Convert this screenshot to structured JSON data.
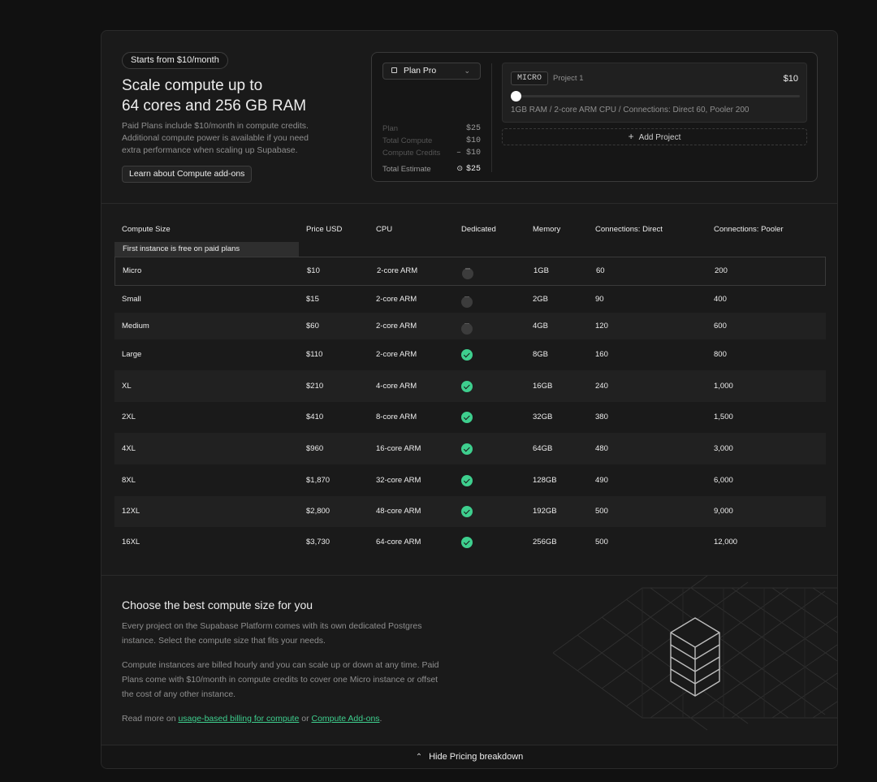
{
  "intro": {
    "pill": "Starts from $10/month",
    "headline_l1": "Scale compute up to",
    "headline_l2": "64 cores and 256 GB RAM",
    "description": "Paid Plans include $10/month in compute credits. Additional compute power is available if you need extra performance when scaling up Supabase.",
    "learn_button": "Learn about Compute add-ons"
  },
  "calculator": {
    "plan_select": "Plan Pro",
    "summary": [
      {
        "label": "Plan",
        "value": "$25"
      },
      {
        "label": "Total Compute",
        "value": "$10"
      },
      {
        "label": "Compute Credits",
        "value": "– $10"
      }
    ],
    "total_label": "Total Estimate",
    "total_value": "$25",
    "project": {
      "size_tag": "MICRO",
      "name": "Project 1",
      "price": "$10",
      "slider_position": 0,
      "specs": "1GB RAM / 2-core ARM CPU / Connections: Direct 60, Pooler 200"
    },
    "add_project": "Add Project"
  },
  "table": {
    "headers": [
      "Compute Size",
      "Price USD",
      "CPU",
      "Dedicated",
      "Memory",
      "Connections: Direct",
      "Connections: Pooler"
    ],
    "free_note": "First instance is free on paid plans",
    "rows": [
      {
        "size": "Micro",
        "price": "$10",
        "cpu": "2-core ARM",
        "dedicated": false,
        "memory": "1GB",
        "direct": "60",
        "pooler": "200"
      },
      {
        "size": "Small",
        "price": "$15",
        "cpu": "2-core ARM",
        "dedicated": false,
        "memory": "2GB",
        "direct": "90",
        "pooler": "400"
      },
      {
        "size": "Medium",
        "price": "$60",
        "cpu": "2-core ARM",
        "dedicated": false,
        "memory": "4GB",
        "direct": "120",
        "pooler": "600"
      },
      {
        "size": "Large",
        "price": "$110",
        "cpu": "2-core ARM",
        "dedicated": true,
        "memory": "8GB",
        "direct": "160",
        "pooler": "800"
      },
      {
        "size": "XL",
        "price": "$210",
        "cpu": "4-core ARM",
        "dedicated": true,
        "memory": "16GB",
        "direct": "240",
        "pooler": "1,000"
      },
      {
        "size": "2XL",
        "price": "$410",
        "cpu": "8-core ARM",
        "dedicated": true,
        "memory": "32GB",
        "direct": "380",
        "pooler": "1,500"
      },
      {
        "size": "4XL",
        "price": "$960",
        "cpu": "16-core ARM",
        "dedicated": true,
        "memory": "64GB",
        "direct": "480",
        "pooler": "3,000"
      },
      {
        "size": "8XL",
        "price": "$1,870",
        "cpu": "32-core ARM",
        "dedicated": true,
        "memory": "128GB",
        "direct": "490",
        "pooler": "6,000"
      },
      {
        "size": "12XL",
        "price": "$2,800",
        "cpu": "48-core ARM",
        "dedicated": true,
        "memory": "192GB",
        "direct": "500",
        "pooler": "9,000"
      },
      {
        "size": "16XL",
        "price": "$3,730",
        "cpu": "64-core ARM",
        "dedicated": true,
        "memory": "256GB",
        "direct": "500",
        "pooler": "12,000"
      }
    ]
  },
  "info": {
    "title": "Choose the best compute size for you",
    "p1": "Every project on the Supabase Platform comes with its own dedicated Postgres instance. Select the compute size that fits your needs.",
    "p2": "Compute instances are billed hourly and you can scale up or down at any time. Paid Plans come with $10/month in compute credits to cover one Micro instance or offset the cost of any other instance.",
    "p3_prefix": "Read more on ",
    "link1": "usage-based billing for compute",
    "p3_mid": " or ",
    "link2": "Compute Add-ons",
    "p3_suffix": "."
  },
  "footer": {
    "hide_label": "Hide Pricing breakdown",
    "caret_icon": "chevron-up-icon"
  },
  "colors": {
    "accent": "#3ecf8e",
    "background": "#111111",
    "card": "#1a1a1a"
  }
}
